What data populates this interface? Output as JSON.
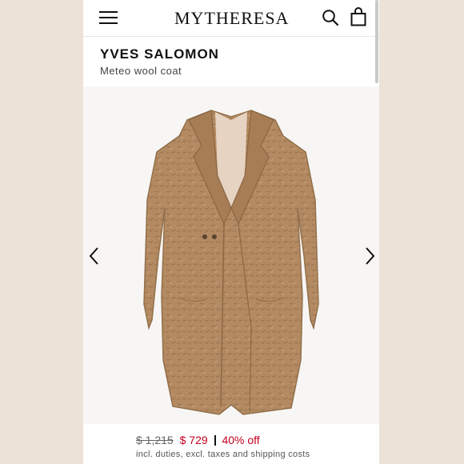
{
  "header": {
    "logo": "MYTHERESA",
    "menu_icon": "hamburger-menu-icon",
    "search_icon": "search-icon",
    "bag_icon": "shopping-bag-icon"
  },
  "product": {
    "brand": "YVES SALOMON",
    "name": "Meteo wool coat",
    "image_icon": "camel-faux-fur-coat"
  },
  "carousel": {
    "prev_icon": "chevron-left-icon",
    "next_icon": "chevron-right-icon"
  },
  "price": {
    "original": "$ 1,215",
    "sale": "$ 729",
    "discount": "40% off",
    "note": "incl. duties, excl. taxes and shipping costs",
    "sale_color": "#c3001e"
  },
  "colors": {
    "side_background": "#ece2d8",
    "coat": "#b38a62"
  }
}
